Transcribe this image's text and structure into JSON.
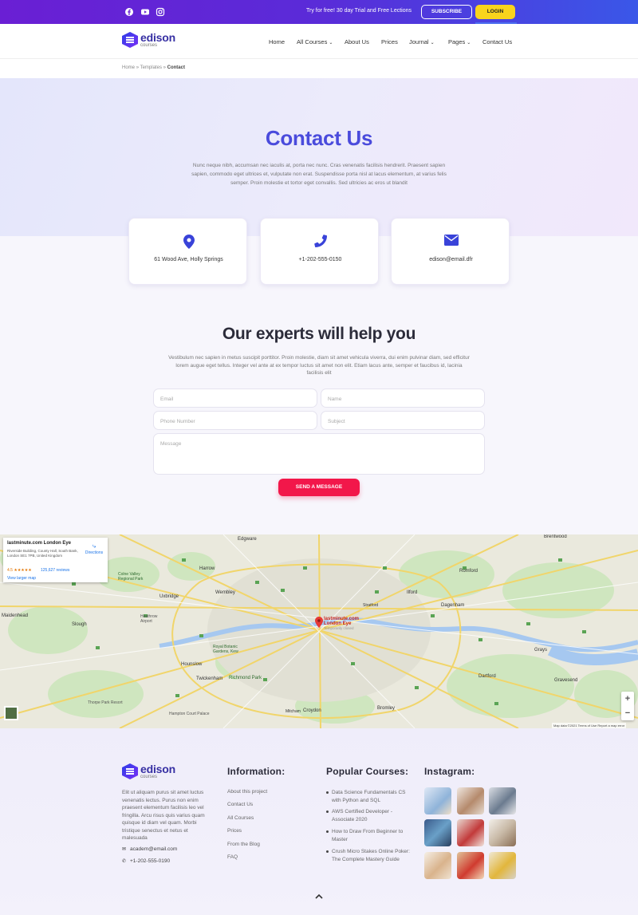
{
  "topbar": {
    "social_icons": [
      "facebook-icon",
      "youtube-icon",
      "instagram-icon"
    ],
    "promo": "Try for free! 30 day Trial and Free Lections",
    "subscribe_label": "SUBSCRIBE",
    "login_label": "LOGIN"
  },
  "brand": {
    "name": "edison",
    "sub": "courses"
  },
  "nav": {
    "items": [
      "Home",
      "All Courses",
      "About Us",
      "Prices",
      "Journal",
      "Pages",
      "Contact Us"
    ]
  },
  "breadcrumb": {
    "home": "Home",
    "sep1": "»",
    "templates": "Templates",
    "sep2": "»",
    "current": "Contact"
  },
  "hero": {
    "title": "Contact Us",
    "description": "Nunc neque nibh, accumsan nec iaculis at, porta nec nunc. Cras venenatis facilisis hendrerit. Praesent sapien sapien, commodo eget ultrices et, vulputate non erat. Suspendisse porta nisl at lacus elementum, at varius felis semper. Proin molestie et tortor eget convallis. Sed ultricies ac eros ut blandit"
  },
  "cards": [
    {
      "icon": "location-pin-icon",
      "text": "61 Wood Ave, Holly Springs"
    },
    {
      "icon": "phone-icon",
      "text": "+1-202-555-0150"
    },
    {
      "icon": "envelope-icon",
      "text": "edison@email.dfr"
    }
  ],
  "form": {
    "title": "Our experts will help you",
    "description": "Vestibulum nec sapien in metus suscipit porttitor. Proin molestie, diam sit amet vehicula viverra, dui enim pulvinar diam, sed efficitur lorem augue eget tellus. Integer vel ante at ex tempor luctus sit amet non elit. Etiam lacus ante, semper et faucibus id, lacinia facilisis elit",
    "email_placeholder": "Email",
    "name_placeholder": "Name",
    "phone_placeholder": "Phone Number",
    "subject_placeholder": "Subject",
    "message_placeholder": "Message",
    "send_label": "SEND A MESSAGE"
  },
  "map": {
    "place_title": "lastminute.com London Eye",
    "place_address": "Riverside Building, County Hall, South Bank, London SE1 7PB, United Kingdom",
    "rating": "4.5 ★★★★★",
    "reviews": "125,627 reviews",
    "larger_map": "View larger map",
    "directions": "Directions",
    "pin_label": "lastminute.com",
    "pin_label2": "London Eye",
    "pin_sub": "Temporarily closed",
    "zoom_in": "+",
    "zoom_out": "−",
    "attribution": "Map data ©2021   Terms of Use   Report a map error",
    "places": [
      "Edgware",
      "Brentwood",
      "Harrow",
      "Wembley",
      "Romford",
      "Uxbridge",
      "Ilford",
      "Slough",
      "Hounslow",
      "Richmond Park",
      "Croydon",
      "Bromley",
      "Dartford",
      "Gravesend",
      "Grays",
      "Maidenhead",
      "Twickenham",
      "Stratford",
      "Dagenham",
      "Mitcham",
      "Heathrow Airport",
      "Royal Botanic Gardens, Kew",
      "Colne Valley Regional Park",
      "Thorpe Park Resort",
      "Hampton Court Palace"
    ]
  },
  "footer": {
    "description": "Elit ut aliquam purus sit amet luctus venenatis lectus. Purus non enim praesent elementum facilisis leo vel fringilla. Arcu risus quis varius quam quisque id diam vel quam. Morbi tristique senectus et netus et malesuada",
    "email": "academ@email.com",
    "phone": "+1-202-555-0190",
    "info_title": "Information:",
    "info_links": [
      "About this project",
      "Contact Us",
      "All Courses",
      "Prices",
      "From the Blog",
      "FAQ"
    ],
    "courses_title": "Popular Courses:",
    "courses": [
      "Data Science Fundamentals CS with Python and SQL",
      "AWS Certified Developer - Associate 2020",
      "How to Draw From Beginner to Master",
      "Crush Micro Stakes Online Poker: The Complete Mastery Guide"
    ],
    "instagram_title": "Instagram:",
    "back_to_top_icon": "chevron-up-icon"
  },
  "colors": {
    "brand": "#4a4bdc",
    "accent": "#f2174a",
    "login": "#f9d41c",
    "topbar": "#6a1fd4"
  }
}
